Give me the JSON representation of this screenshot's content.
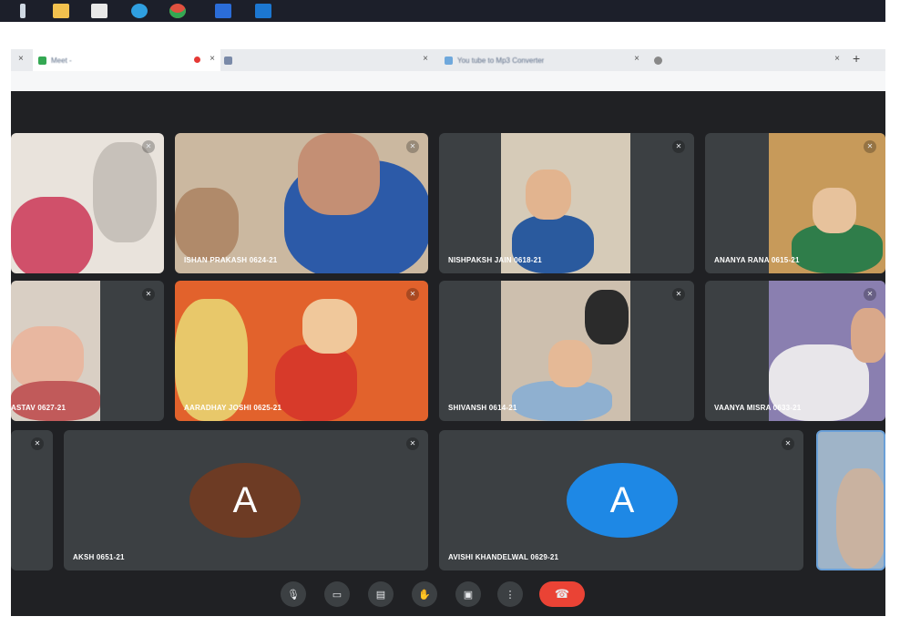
{
  "taskbar": {
    "icons": [
      "windows-icon",
      "file-explorer-icon",
      "store-icon",
      "edge-icon",
      "chrome-icon",
      "word-icon",
      "media-icon"
    ]
  },
  "browser": {
    "tabs": [
      {
        "label": "Meet - "
      },
      {
        "label": ""
      },
      {
        "label": "You tube to Mp3 Converter"
      },
      {
        "label": ""
      }
    ],
    "close_glyph": "×",
    "new_tab_glyph": "+"
  },
  "participants": [
    {
      "name": "ASTAV 0627-21"
    },
    {
      "name": "ISHAN PRAKASH 0624-21"
    },
    {
      "name": "NISHPAKSH JAIN 0618-21"
    },
    {
      "name": "ANANYA RANA 0615-21"
    },
    {
      "name": "AARADHAY JOSHI 0625-21"
    },
    {
      "name": "SHIVANSH 0614-21"
    },
    {
      "name": "VAANYA MISRA 0633-21"
    },
    {
      "name": "AKSH 0651-21",
      "initial": "A",
      "color": "#6d3b24"
    },
    {
      "name": "AVISHI KHANDELWAL 0629-21",
      "initial": "A",
      "color": "#1e88e5"
    }
  ],
  "controls": {
    "mic": "🎙",
    "camera": "▭",
    "captions": "▤",
    "raise_hand": "✋",
    "present": "▣",
    "more": "⋮",
    "hang_up": "☎"
  },
  "colors": {
    "meet_bg": "#202124",
    "tile_bg": "#3c4043",
    "hang_up": "#ea4335"
  }
}
